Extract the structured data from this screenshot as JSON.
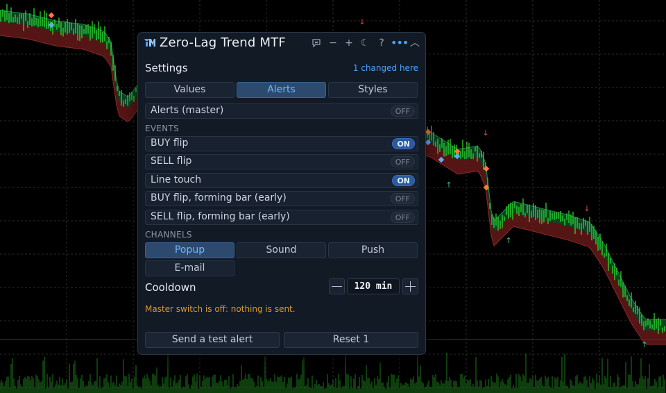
{
  "panel": {
    "title": "Zero-Lag Trend MTF",
    "toolbar_icons": [
      "chat-off-icon",
      "minus-icon",
      "plus-icon",
      "moon-icon",
      "help-icon",
      "more-icon",
      "collapse-icon"
    ],
    "toolbar_glyphs": {
      "minus": "−",
      "plus": "+",
      "moon": "☾",
      "help": "?",
      "more": "•••",
      "collapse": "︿"
    },
    "settings_label": "Settings",
    "changed_note": "1 changed here",
    "tabs": [
      {
        "label": "Values",
        "active": false
      },
      {
        "label": "Alerts",
        "active": true
      },
      {
        "label": "Styles",
        "active": false
      }
    ],
    "master": {
      "label": "Alerts (master)",
      "state": "OFF"
    },
    "events_header": "EVENTS",
    "events": [
      {
        "label": "BUY flip",
        "state": "ON"
      },
      {
        "label": "SELL flip",
        "state": "OFF"
      },
      {
        "label": "Line touch",
        "state": "ON"
      },
      {
        "label": "BUY flip, forming bar (early)",
        "state": "OFF"
      },
      {
        "label": "SELL flip, forming bar (early)",
        "state": "OFF"
      }
    ],
    "channels_header": "CHANNELS",
    "channels": [
      {
        "label": "Popup",
        "active": true
      },
      {
        "label": "Sound",
        "active": false
      },
      {
        "label": "Push",
        "active": false
      },
      {
        "label": "E-mail",
        "active": false
      }
    ],
    "cooldown": {
      "label": "Cooldown",
      "value": "120 min"
    },
    "warning": "Master switch is off: nothing is sent.",
    "buttons": {
      "test": "Send a test alert",
      "reset": "Reset 1"
    }
  },
  "colors": {
    "accent": "#4ea3ff",
    "warning": "#d99a2b",
    "bull_candle": "#2ee62e",
    "bear_band": "#7a1e1e",
    "bull_band": "#0f5a2e",
    "up_arrow": "#3cc47a",
    "down_arrow": "#e0484a"
  }
}
